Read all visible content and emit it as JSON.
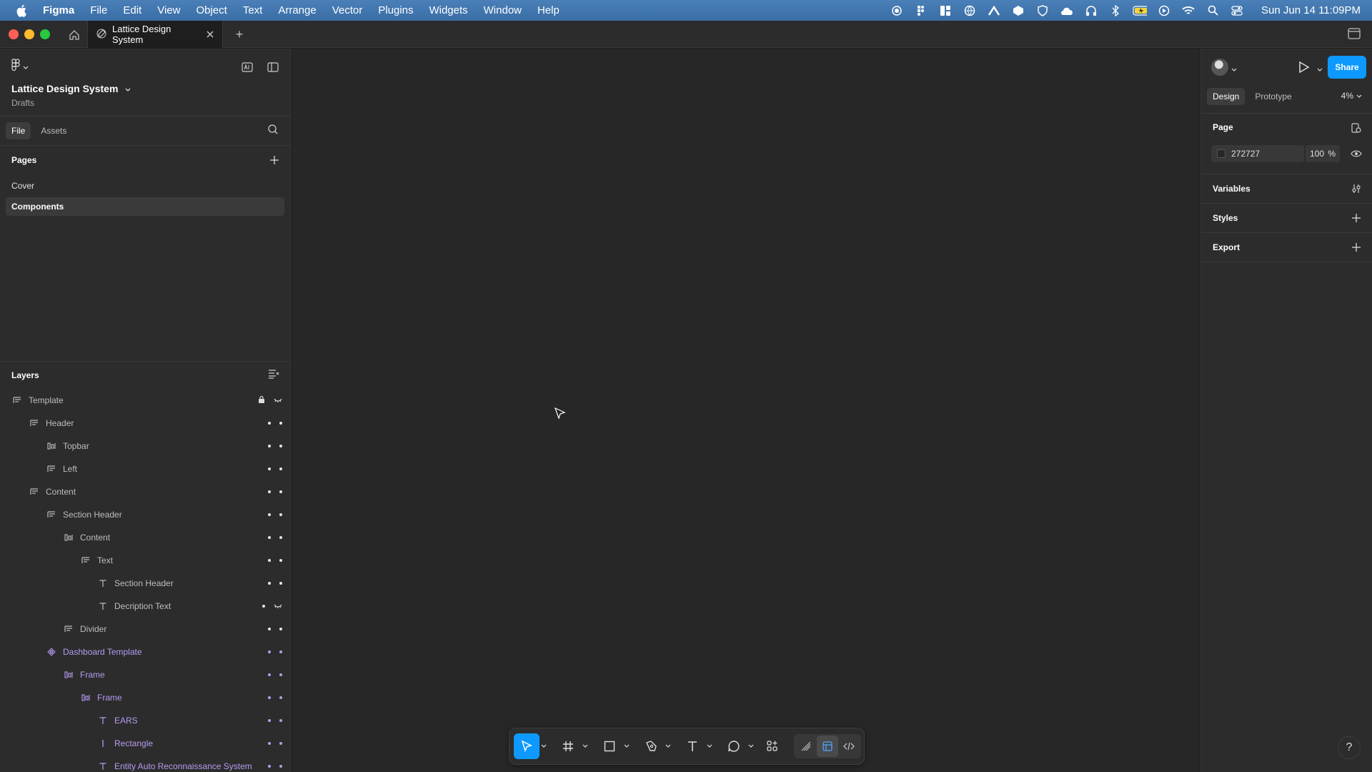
{
  "menubar": {
    "app_name": "Figma",
    "items": [
      "File",
      "Edit",
      "View",
      "Object",
      "Text",
      "Arrange",
      "Vector",
      "Plugins",
      "Widgets",
      "Window",
      "Help"
    ],
    "clock": "Sun Jun 14  11:09PM"
  },
  "tabbar": {
    "doc_tab_title": "Lattice Design System",
    "new_tab_symbol": "+"
  },
  "leftpanel": {
    "file_title": "Lattice Design System",
    "file_location": "Drafts",
    "tabs": [
      "File",
      "Assets"
    ],
    "pages_heading": "Pages",
    "pages": [
      "Cover",
      "Components"
    ],
    "active_page": "Components",
    "layers_heading": "Layers",
    "layers": [
      {
        "name": "Template",
        "indent": 0,
        "icon": "frame-icon"
      },
      {
        "name": "Header",
        "indent": 1,
        "icon": "frame-icon"
      },
      {
        "name": "Topbar",
        "indent": 2,
        "icon": "autolayout-horizontal-icon"
      },
      {
        "name": "Left",
        "indent": 2,
        "icon": "frame-icon"
      },
      {
        "name": "Content",
        "indent": 1,
        "icon": "frame-icon"
      },
      {
        "name": "Section Header",
        "indent": 2,
        "icon": "frame-icon"
      },
      {
        "name": "Content",
        "indent": 3,
        "icon": "autolayout-horizontal-icon"
      },
      {
        "name": "Text",
        "indent": 4,
        "icon": "frame-icon"
      },
      {
        "name": "Section Header",
        "indent": 5,
        "icon": "text-icon"
      },
      {
        "name": "Decription Text",
        "indent": 5,
        "icon": "text-icon"
      },
      {
        "name": "Divider",
        "indent": 3,
        "icon": "frame-icon"
      },
      {
        "name": "Dashboard Template",
        "indent": 2,
        "icon": "component-icon"
      },
      {
        "name": "Frame",
        "indent": 3,
        "icon": "autolayout-horizontal-icon"
      },
      {
        "name": "Frame",
        "indent": 4,
        "icon": "autolayout-horizontal-icon"
      },
      {
        "name": "EARS",
        "indent": 5,
        "icon": "text-icon"
      },
      {
        "name": "Rectangle",
        "indent": 5,
        "icon": "rectangle-line-icon"
      },
      {
        "name": "Entity Auto Reconnaissance System",
        "indent": 5,
        "icon": "text-icon"
      }
    ]
  },
  "rightpanel": {
    "share_label": "Share",
    "tabs": [
      "Design",
      "Prototype"
    ],
    "zoom": "4%",
    "page_heading": "Page",
    "page_fill_hex": "272727",
    "page_fill_opacity": "100",
    "percent_symbol": "%",
    "variables_heading": "Variables",
    "styles_heading": "Styles",
    "export_heading": "Export"
  },
  "help_symbol": "?",
  "colors": {
    "accent": "#0d99ff",
    "canvas": "#272727",
    "panel": "#2c2c2c",
    "component_purple": "#b59bf0"
  }
}
